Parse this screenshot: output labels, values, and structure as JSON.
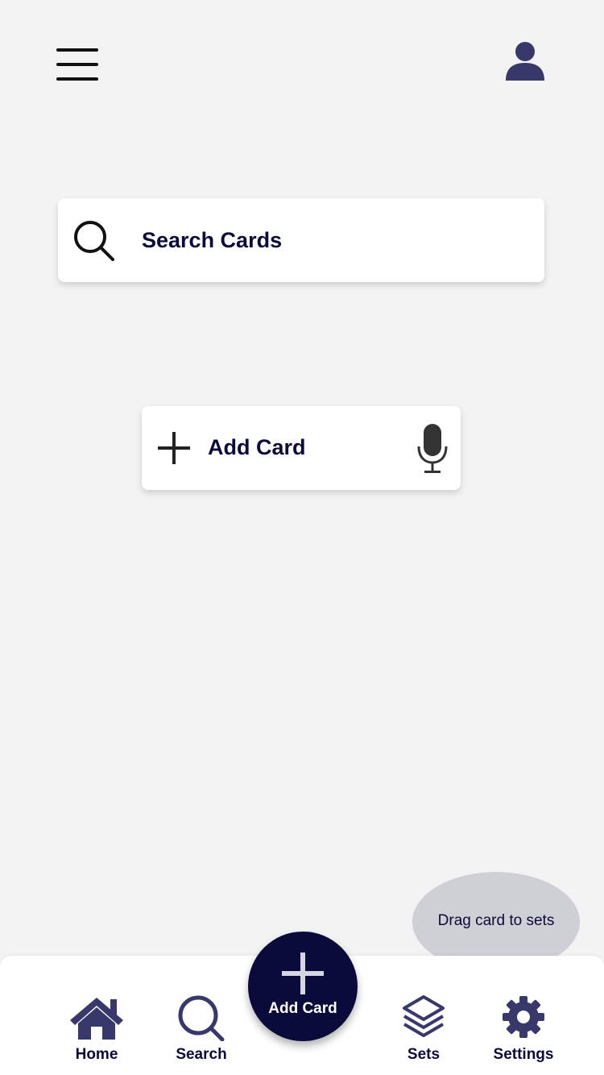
{
  "header": {
    "menu_icon": "hamburger-menu-icon",
    "profile_icon": "user-profile-icon"
  },
  "search": {
    "placeholder": "Search Cards",
    "icon": "search-icon"
  },
  "add_card": {
    "label": "Add Card",
    "plus_icon": "plus-icon",
    "mic_icon": "microphone-icon"
  },
  "tooltip": {
    "text": "Drag card to sets"
  },
  "nav": {
    "home": "Home",
    "search": "Search",
    "fab": "Add Card",
    "sets": "Sets",
    "settings": "Settings"
  },
  "colors": {
    "background": "#f3f3f3",
    "primary": "#0b0b3b",
    "icon": "#38386b",
    "bubble": "#cfcfd6"
  }
}
